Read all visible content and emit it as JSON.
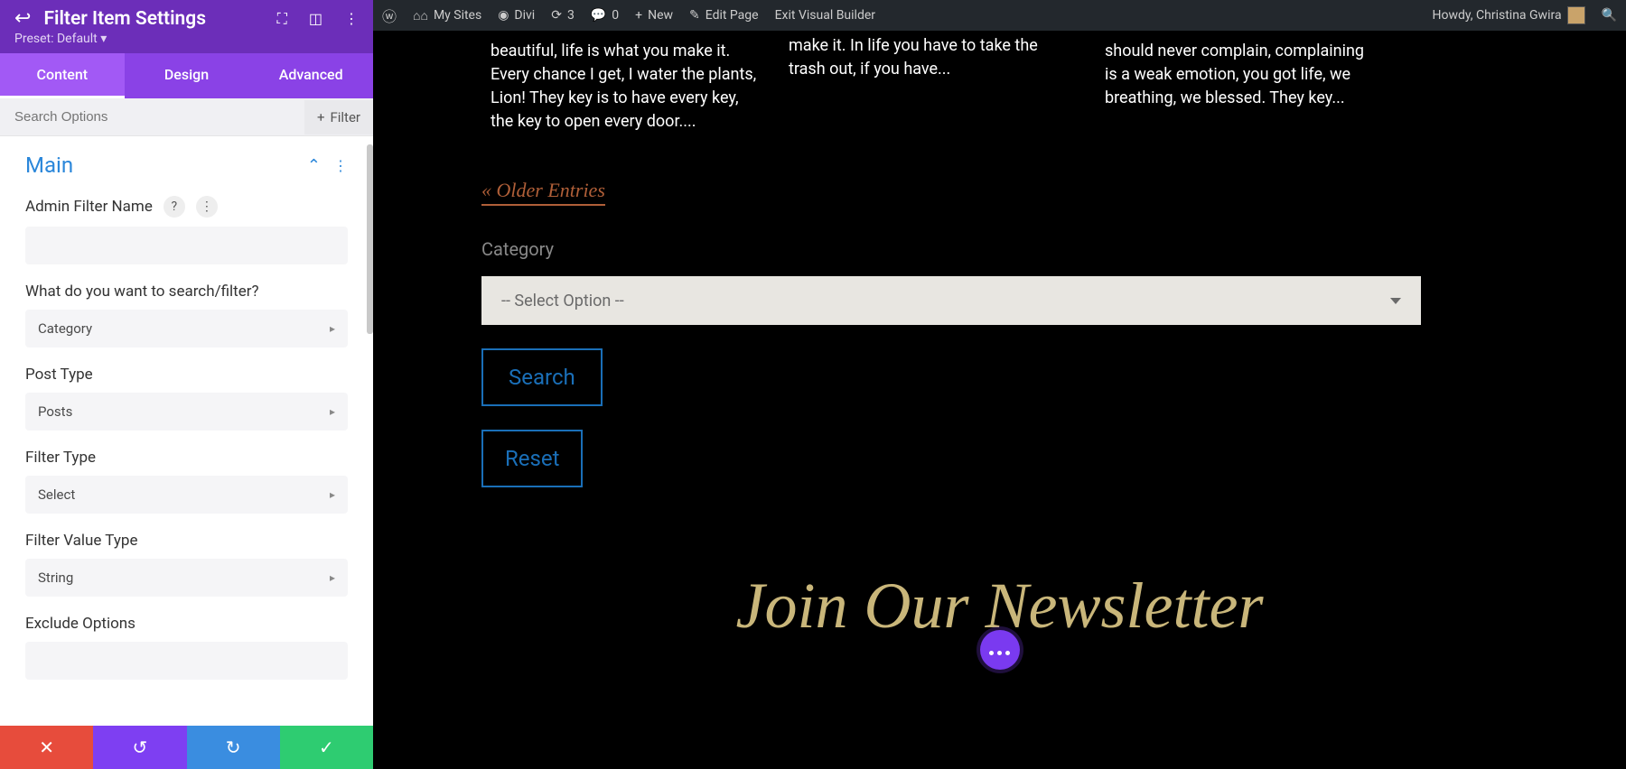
{
  "panel": {
    "title": "Filter Item Settings",
    "preset": "Preset: Default ▾",
    "tabs": {
      "content": "Content",
      "design": "Design",
      "advanced": "Advanced"
    },
    "search_placeholder": "Search Options",
    "filter_btn": "Filter",
    "section_title": "Main",
    "fields": {
      "admin_filter_name": "Admin Filter Name",
      "what_filter": "What do you want to search/filter?",
      "what_filter_value": "Category",
      "post_type": "Post Type",
      "post_type_value": "Posts",
      "filter_type": "Filter Type",
      "filter_type_value": "Select",
      "filter_value_type": "Filter Value Type",
      "filter_value_type_value": "String",
      "exclude_options": "Exclude Options"
    }
  },
  "adminbar": {
    "my_sites": "My Sites",
    "divi": "Divi",
    "updates": "3",
    "comments": "0",
    "new": "New",
    "edit_page": "Edit Page",
    "exit_vb": "Exit Visual Builder",
    "howdy": "Howdy, Christina Gwira"
  },
  "page": {
    "post1": "beautiful, life is what you make it. Every chance I get, I water the plants, Lion! They key is to have every key, the key to open every door....",
    "post2": "make it. In life you have to take the trash out, if you have...",
    "post3": "should never complain, complaining is a weak emotion, you got life, we breathing, we blessed. They key...",
    "older_entries": "« Older Entries",
    "category_label": "Category",
    "select_placeholder": "-- Select Option --",
    "search_btn": "Search",
    "reset_btn": "Reset",
    "newsletter_heading": "Join Our Newsletter"
  }
}
